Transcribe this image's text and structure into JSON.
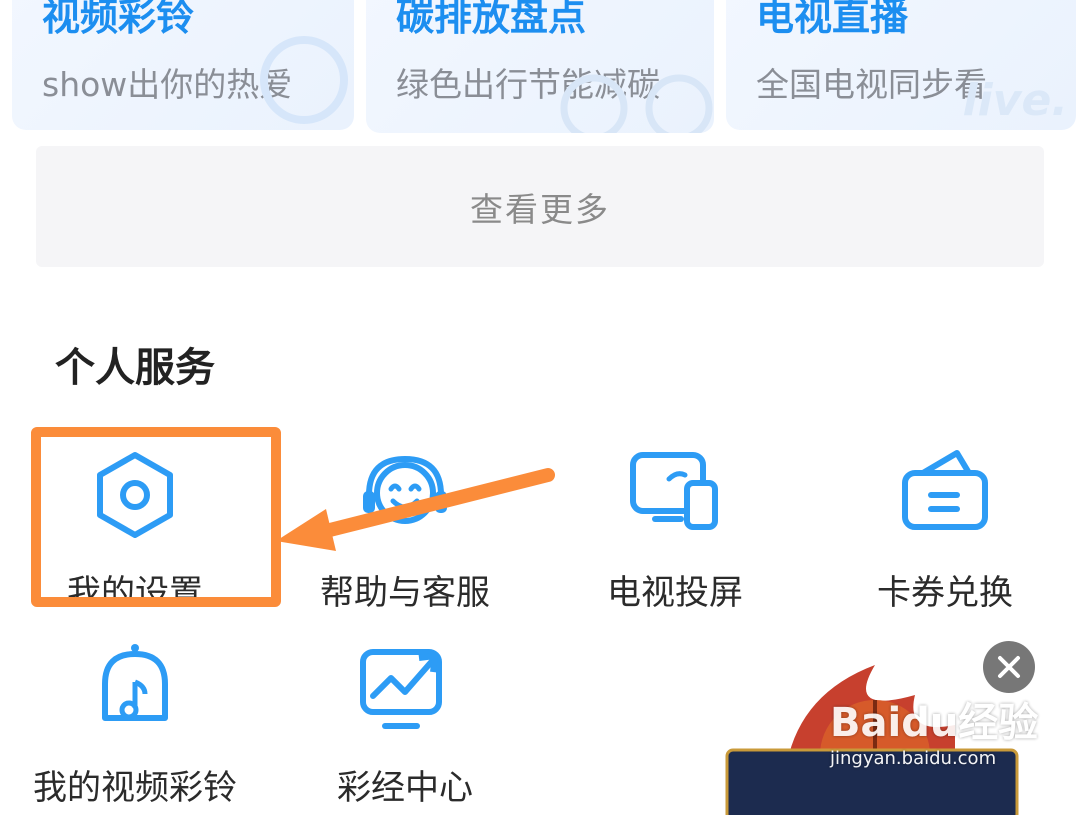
{
  "top_cards": [
    {
      "title": "视频彩铃",
      "subtitle": "show出你的热爱"
    },
    {
      "title": "碳排放盘点",
      "subtitle": "绿色出行节能减碳"
    },
    {
      "title": "电视直播",
      "subtitle": "全国电视同步看"
    }
  ],
  "more_button": "查看更多",
  "personal_services": {
    "title": "个人服务",
    "items": [
      {
        "label": "我的设置",
        "icon": "settings-hexagon-icon"
      },
      {
        "label": "帮助与客服",
        "icon": "customer-service-headset-icon"
      },
      {
        "label": "电视投屏",
        "icon": "screen-cast-icon"
      },
      {
        "label": "卡券兑换",
        "icon": "coupon-wallet-icon"
      },
      {
        "label": "我的视频彩铃",
        "icon": "bell-music-icon"
      },
      {
        "label": "彩经中心",
        "icon": "trend-chart-icon"
      }
    ]
  },
  "card_decor_text": "live.",
  "watermark": {
    "main": "Baidu经验",
    "sub": "jingyan.baidu.com"
  },
  "colors": {
    "accent": "#1c8ef0",
    "icon": "#2d9cf5",
    "highlight": "#fb8c3a"
  }
}
